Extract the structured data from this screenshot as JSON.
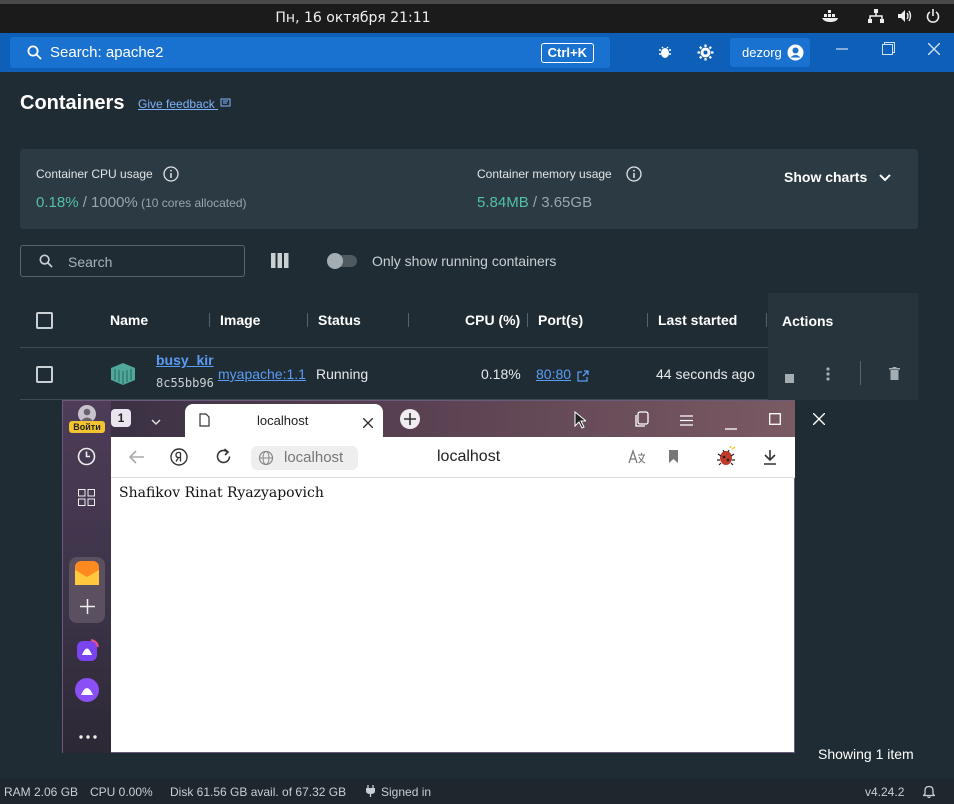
{
  "system": {
    "datetime": "Пн, 16 октября  21:11"
  },
  "appbar": {
    "search_label": "Search: apache2",
    "shortcut": "Ctrl+K",
    "user": "dezorg"
  },
  "page": {
    "title": "Containers",
    "feedback": "Give feedback"
  },
  "stats": {
    "cpu_label": "Container CPU usage",
    "cpu_value": "0.18%",
    "cpu_total": " / 1000%",
    "cpu_note": " (10 cores allocated)",
    "mem_label": "Container memory usage",
    "mem_value": "5.84MB",
    "mem_total": " / 3.65GB",
    "show_charts": "Show charts"
  },
  "filter": {
    "search_placeholder": "Search",
    "running_only": "Only show running containers"
  },
  "table": {
    "headers": [
      "Name",
      "Image",
      "Status",
      "CPU (%)",
      "Port(s)",
      "Last started",
      "Actions"
    ],
    "rows": [
      {
        "name": "busy_kir",
        "id": "8c55bb96",
        "image": "myapache:1.1",
        "status": "Running",
        "cpu": "0.18%",
        "ports": "80:80",
        "last_started": "44 seconds ago"
      }
    ]
  },
  "browser": {
    "login_badge": "Войти",
    "tab_count": "1",
    "tab_title": "localhost",
    "address_host": "localhost",
    "address_title": "localhost",
    "page_text": "Shafikov Rinat Ryazyapovich"
  },
  "footer": {
    "showing": "Showing 1 item"
  },
  "statusbar": {
    "ram": "RAM 2.06 GB",
    "cpu": "CPU 0.00%",
    "disk": "Disk 61.56 GB avail. of 67.32 GB",
    "signed_in": "Signed in",
    "version": "v4.24.2"
  },
  "colors": {
    "accent": "#0d5fb8",
    "usage_green": "#51c0a6",
    "link": "#5a9cf5"
  }
}
